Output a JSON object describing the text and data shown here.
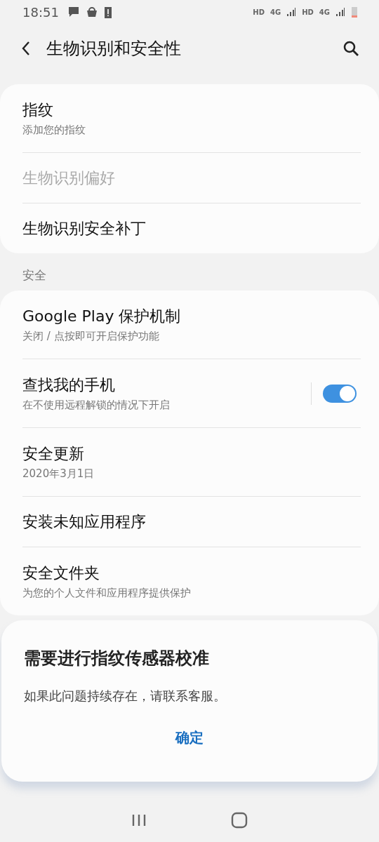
{
  "status_bar": {
    "time": "18:51",
    "signal_labels": [
      "HD",
      "4G",
      "HD",
      "4G"
    ]
  },
  "app_bar": {
    "title": "生物识别和安全性"
  },
  "groups": [
    {
      "items": [
        {
          "kind": "plain",
          "title": "指纹",
          "subtitle": "添加您的指纹",
          "disabled": false
        },
        {
          "kind": "plain",
          "title": "生物识别偏好",
          "disabled": true
        },
        {
          "kind": "plain",
          "title": "生物识别安全补丁",
          "disabled": false
        }
      ]
    },
    {
      "header": "安全",
      "items": [
        {
          "kind": "plain",
          "title": "Google Play 保护机制",
          "subtitle": "关闭 / 点按即可开启保护功能",
          "disabled": false
        },
        {
          "kind": "toggle",
          "title": "查找我的手机",
          "subtitle": "在不使用远程解锁的情况下开启",
          "disabled": false,
          "on": true
        },
        {
          "kind": "plain",
          "title": "安全更新",
          "subtitle": "2020年3月1日",
          "disabled": false
        },
        {
          "kind": "plain",
          "title": "安装未知应用程序",
          "disabled": false
        },
        {
          "kind": "plain",
          "title": "安全文件夹",
          "subtitle": "为您的个人文件和应用程序提供保护",
          "disabled": false
        }
      ]
    }
  ],
  "dialog": {
    "title": "需要进行指纹传感器校准",
    "message": "如果此问题持续存在，请联系客服。",
    "button": "确定"
  }
}
